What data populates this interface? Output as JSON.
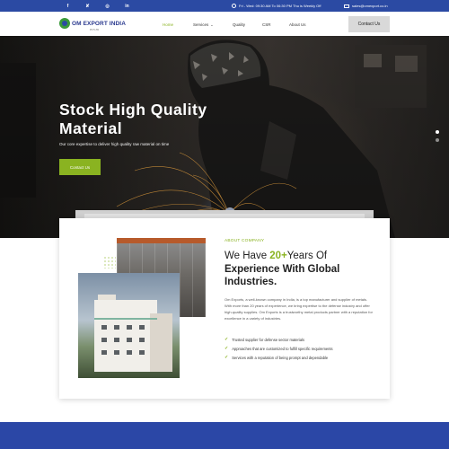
{
  "topbar": {
    "socials": [
      "f",
      "✘",
      "◎",
      "in"
    ],
    "social_names": [
      "facebook-icon",
      "x-twitter-icon",
      "instagram-icon",
      "linkedin-icon"
    ],
    "hours": "Fri - Wed: 09:30 AM To 06:30 PM Thu is Weekly Off",
    "email": "sales@omexport.co.in"
  },
  "header": {
    "logo_text": "OM EXPORT INDIA",
    "logo_sub": "PVT LTD",
    "nav": [
      {
        "label": "Home",
        "active": true
      },
      {
        "label": "Services",
        "dropdown": true
      },
      {
        "label": "Quality"
      },
      {
        "label": "CSR"
      },
      {
        "label": "About Us"
      }
    ],
    "contact_label": "Contact Us"
  },
  "hero": {
    "title": "Stock High Quality Material",
    "subtitle": "Our core expertise to deliver high quality raw material on time",
    "button_label": "Contact Us",
    "slides_active": 0
  },
  "about": {
    "label": "ABOUT COMPANY",
    "heading_pre": "We Have ",
    "heading_highlight": "20+",
    "heading_mid": "Years Of",
    "heading_bold": "Experience With Global Industries.",
    "paragraph": "Om Exports, a well-known company in India, is a top manufacturer and supplier of metals. With more than 20 years of experience, we bring expertise to the defense industry and offer high-quality supplies. Om Exports is a trustworthy metal products partner with a reputation for excellence in a variety of industries.",
    "bullets": [
      "Trusted supplier for defense sector materials",
      "Approaches that are customized to fulfill specific requirements",
      "Services with a reputation of being prompt and dependable"
    ]
  },
  "colors": {
    "brand_blue": "#2b4aa3",
    "accent_green": "#8ab321"
  }
}
